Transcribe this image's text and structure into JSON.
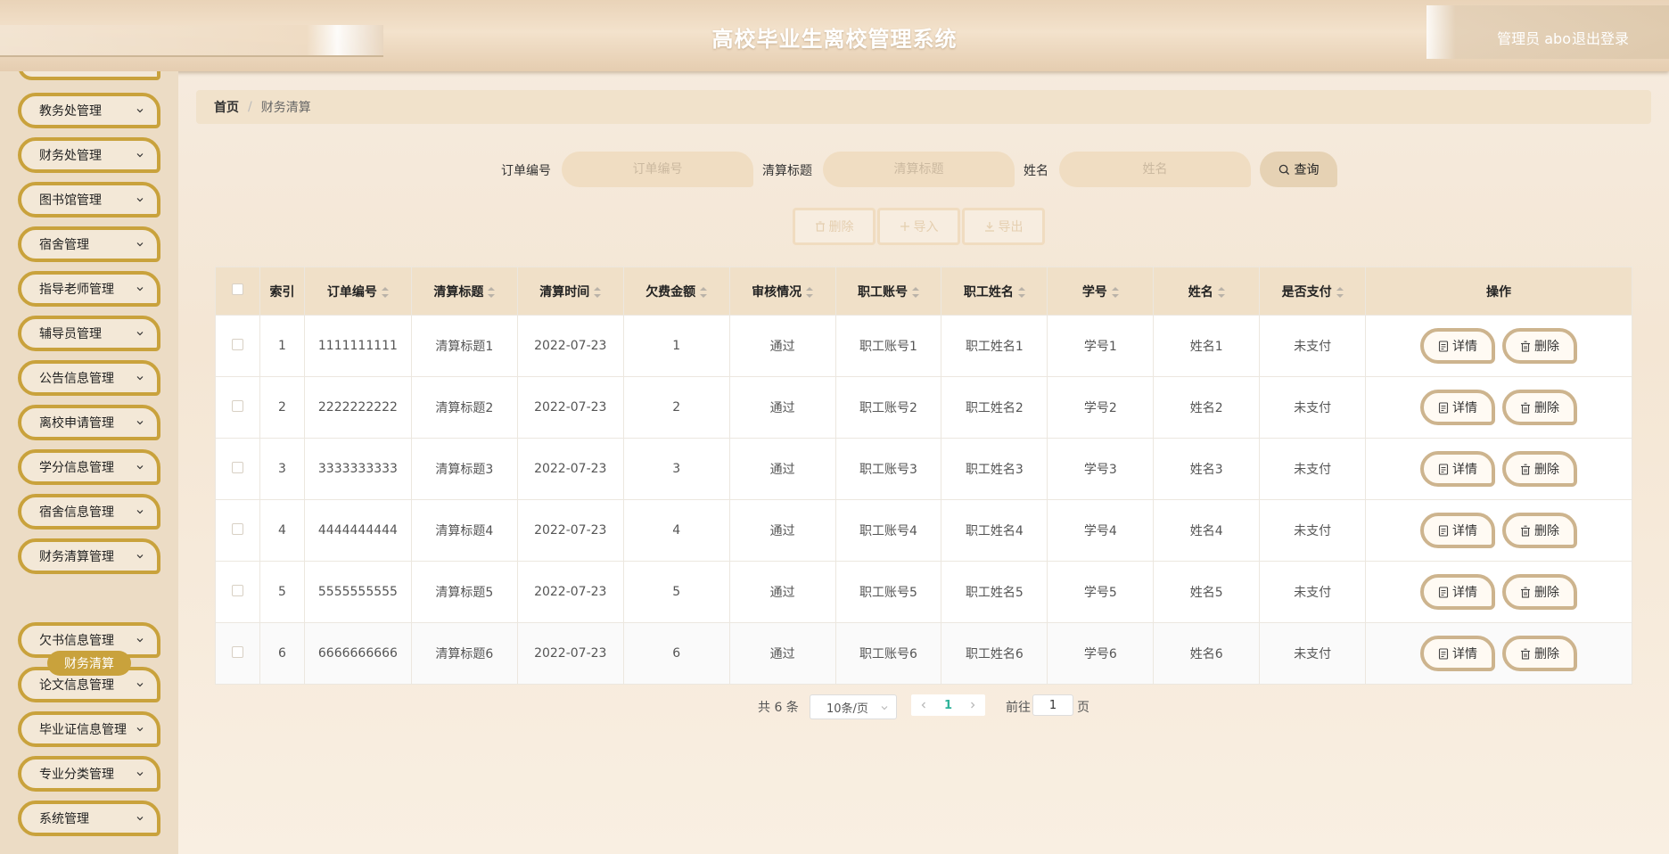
{
  "header": {
    "title": "高校毕业生离校管理系统",
    "user": "管理员 abo",
    "logout": "退出登录"
  },
  "sidebar": {
    "items": [
      {
        "label": "教务处管理"
      },
      {
        "label": "财务处管理"
      },
      {
        "label": "图书馆管理"
      },
      {
        "label": "宿舍管理"
      },
      {
        "label": "指导老师管理"
      },
      {
        "label": "辅导员管理"
      },
      {
        "label": "公告信息管理"
      },
      {
        "label": "离校申请管理"
      },
      {
        "label": "学分信息管理"
      },
      {
        "label": "宿舍信息管理"
      },
      {
        "label": "财务清算管理"
      },
      {
        "label": "欠书信息管理"
      },
      {
        "label": "论文信息管理"
      },
      {
        "label": "毕业证信息管理"
      },
      {
        "label": "专业分类管理"
      },
      {
        "label": "系统管理"
      }
    ],
    "active_sub": "财务清算"
  },
  "breadcrumb": {
    "home": "首页",
    "separator": "/",
    "current": "财务清算"
  },
  "search": {
    "order_label": "订单编号",
    "order_placeholder": "订单编号",
    "title_label": "清算标题",
    "title_placeholder": "清算标题",
    "name_label": "姓名",
    "name_placeholder": "姓名",
    "query_button": "查询"
  },
  "actions": {
    "delete": "删除",
    "import": "导入",
    "export": "导出"
  },
  "table": {
    "headers": [
      "索引",
      "订单编号",
      "清算标题",
      "清算时间",
      "欠费金额",
      "审核情况",
      "职工账号",
      "职工姓名",
      "学号",
      "姓名",
      "是否支付",
      "操作"
    ],
    "rows": [
      [
        "1",
        "1111111111",
        "清算标题1",
        "2022-07-23",
        "1",
        "通过",
        "职工账号1",
        "职工姓名1",
        "学号1",
        "姓名1",
        "未支付"
      ],
      [
        "2",
        "2222222222",
        "清算标题2",
        "2022-07-23",
        "2",
        "通过",
        "职工账号2",
        "职工姓名2",
        "学号2",
        "姓名2",
        "未支付"
      ],
      [
        "3",
        "3333333333",
        "清算标题3",
        "2022-07-23",
        "3",
        "通过",
        "职工账号3",
        "职工姓名3",
        "学号3",
        "姓名3",
        "未支付"
      ],
      [
        "4",
        "4444444444",
        "清算标题4",
        "2022-07-23",
        "4",
        "通过",
        "职工账号4",
        "职工姓名4",
        "学号4",
        "姓名4",
        "未支付"
      ],
      [
        "5",
        "5555555555",
        "清算标题5",
        "2022-07-23",
        "5",
        "通过",
        "职工账号5",
        "职工姓名5",
        "学号5",
        "姓名5",
        "未支付"
      ],
      [
        "6",
        "6666666666",
        "清算标题6",
        "2022-07-23",
        "6",
        "通过",
        "职工账号6",
        "职工姓名6",
        "学号6",
        "姓名6",
        "未支付"
      ]
    ],
    "detail_button": "详情",
    "delete_button": "删除"
  },
  "pagination": {
    "total": "共 6 条",
    "page_size": "10条/页",
    "current_page": "1",
    "goto_label": "前往",
    "goto_value": "1",
    "page_suffix": "页"
  },
  "colors": {
    "accent": "#c9a23c",
    "header_bg": "#ecd8bd",
    "table_header_bg": "#f0e0c8",
    "pager_active": "#2fb39a"
  }
}
